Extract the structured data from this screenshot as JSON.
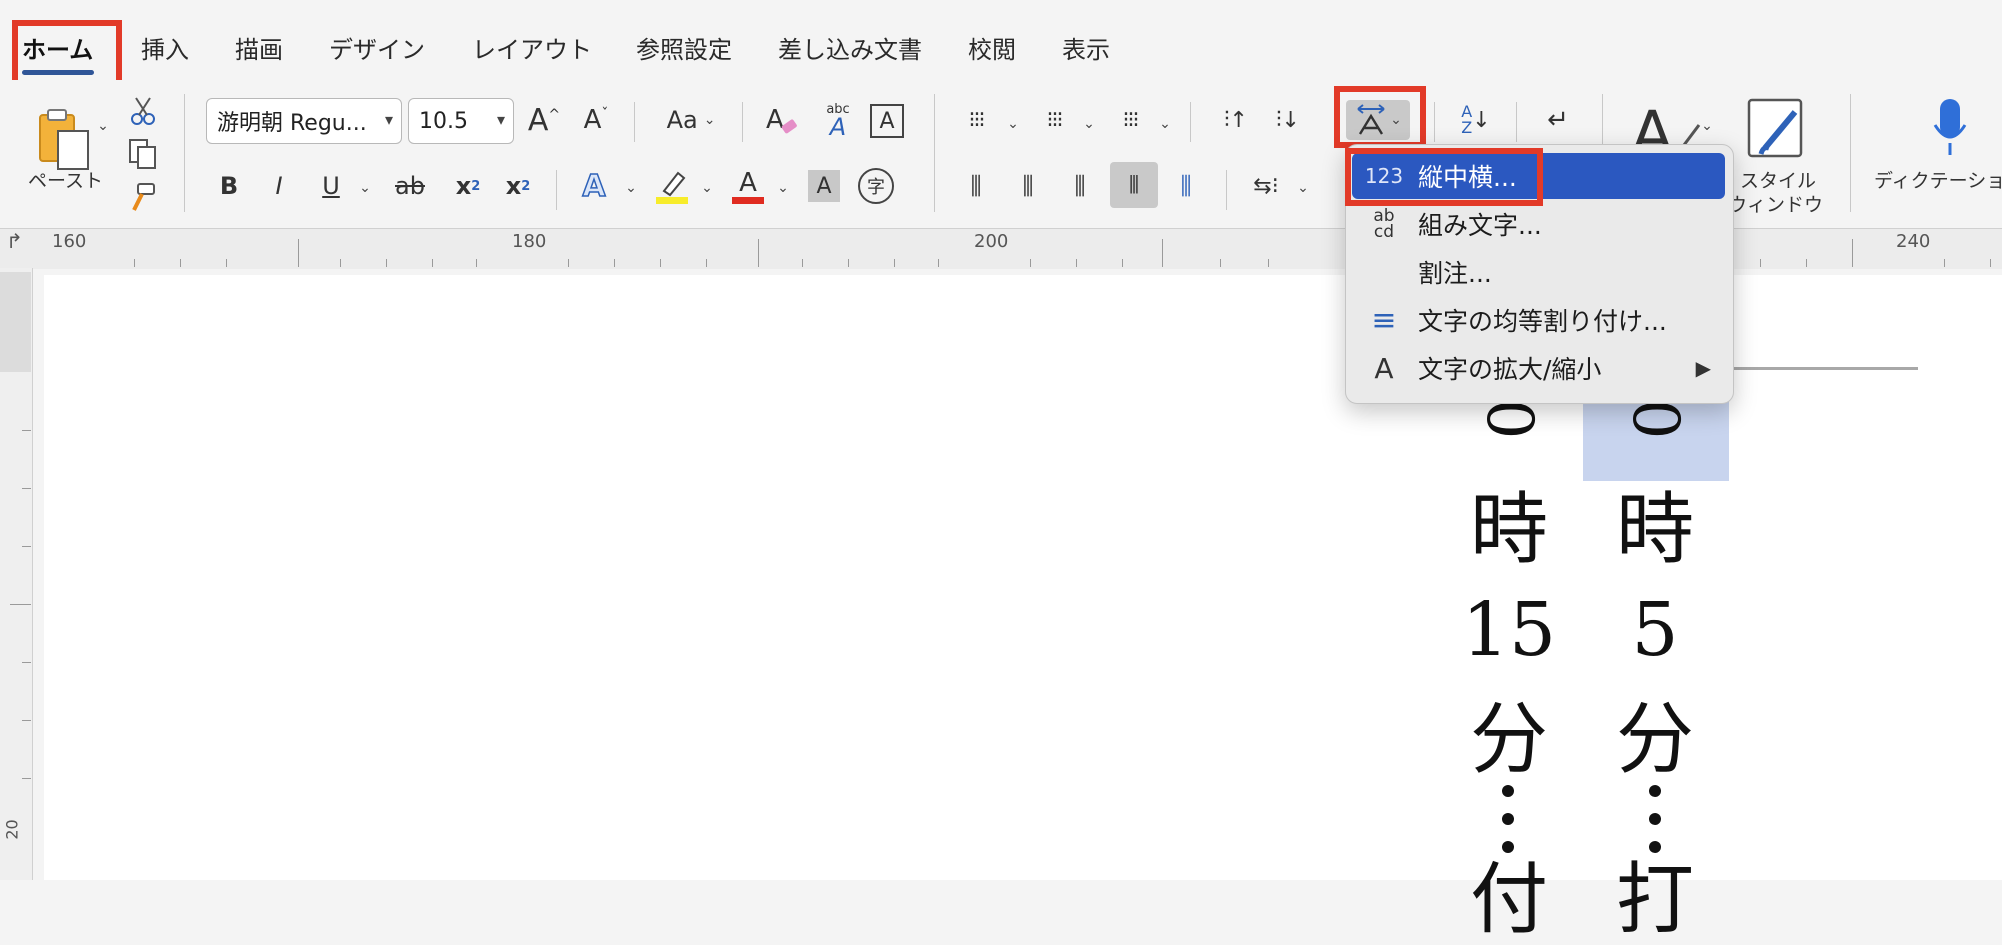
{
  "tabs": [
    "ホーム",
    "挿入",
    "描画",
    "デザイン",
    "レイアウト",
    "参照設定",
    "差し込み文書",
    "校閲",
    "表示"
  ],
  "ribbon": {
    "paste_label": "ペースト",
    "font_name": "游明朝 Regu...",
    "font_size": "10.5",
    "change_case": "Aa",
    "bold": "B",
    "italic": "I",
    "underline": "U",
    "strike": "ab",
    "subscript": "x",
    "superscript": "x",
    "sub_mark": "2",
    "sup_mark": "2",
    "clear_fmt_text": "abc",
    "char_border_text": "A",
    "text_effect": "A",
    "font_color_glyph": "A",
    "shading_glyph": "A",
    "enclose_char": "字",
    "style_pane_label_1": "スタイル",
    "style_pane_label_2": "ウィンドウ",
    "dictation_label": "ディクテーショ"
  },
  "ruler": {
    "numbers": [
      "160",
      "180",
      "200",
      "240"
    ],
    "vertical_number": "20"
  },
  "document": {
    "col1": {
      "zero": "0",
      "ji": "時",
      "num": "15",
      "fun": "分",
      "bottom": "付"
    },
    "col2": {
      "zero": "0",
      "ji": "時",
      "num": "5",
      "fun": "分",
      "bottom": "打"
    }
  },
  "menu": {
    "items": [
      {
        "icon_text": "123",
        "label": "縦中横...",
        "selected": true
      },
      {
        "icon_text": "ab cd",
        "label": "組み文字..."
      },
      {
        "icon_text": "",
        "label": "割注..."
      },
      {
        "icon_text": "≡",
        "label": "文字の均等割り付け..."
      },
      {
        "icon_text": "A",
        "label": "文字の拡大/縮小",
        "submenu_arrow": "▶"
      }
    ]
  },
  "colors": {
    "highlight_red": "#e23a28",
    "menu_selection": "#2b58c0",
    "text_selection": "#c8d4ee",
    "accent_blue": "#2f5597"
  }
}
